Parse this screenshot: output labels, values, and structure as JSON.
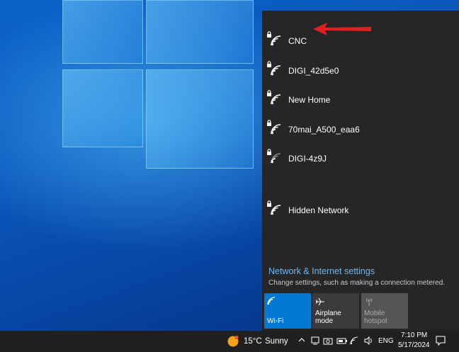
{
  "networks": [
    {
      "name": "CNC",
      "secured": true
    },
    {
      "name": "DIGI_42d5e0",
      "secured": true
    },
    {
      "name": "New Home",
      "secured": true
    },
    {
      "name": "70mai_A500_eaa6",
      "secured": true
    },
    {
      "name": "DIGI-4z9J",
      "secured": true
    },
    {
      "name": "Hidden Network",
      "secured": true
    }
  ],
  "settings": {
    "link": "Network & Internet settings",
    "description": "Change settings, such as making a connection metered."
  },
  "tiles": {
    "wifi": {
      "label": "Wi-Fi",
      "active": true
    },
    "airplane": {
      "label": "Airplane mode",
      "active": false
    },
    "hotspot": {
      "label_line1": "Mobile",
      "label_line2": "hotspot",
      "disabled": true
    }
  },
  "taskbar": {
    "weather_temp": "15°C",
    "weather_condition": "Sunny",
    "language": "ENG",
    "time": "7:10 PM",
    "date": "5/17/2024"
  },
  "icons": {
    "wifi_secured": "wifi-lock-icon",
    "airplane": "airplane-icon",
    "hotspot": "hotspot-icon",
    "weather": "sun-icon",
    "chevron": "chevron-up-icon",
    "notification": "action-center-icon"
  },
  "colors": {
    "flyout_bg": "#262626",
    "accent": "#0078d4",
    "link": "#6fb7f4",
    "arrow": "#e02020",
    "taskbar_bg": "#202020"
  }
}
